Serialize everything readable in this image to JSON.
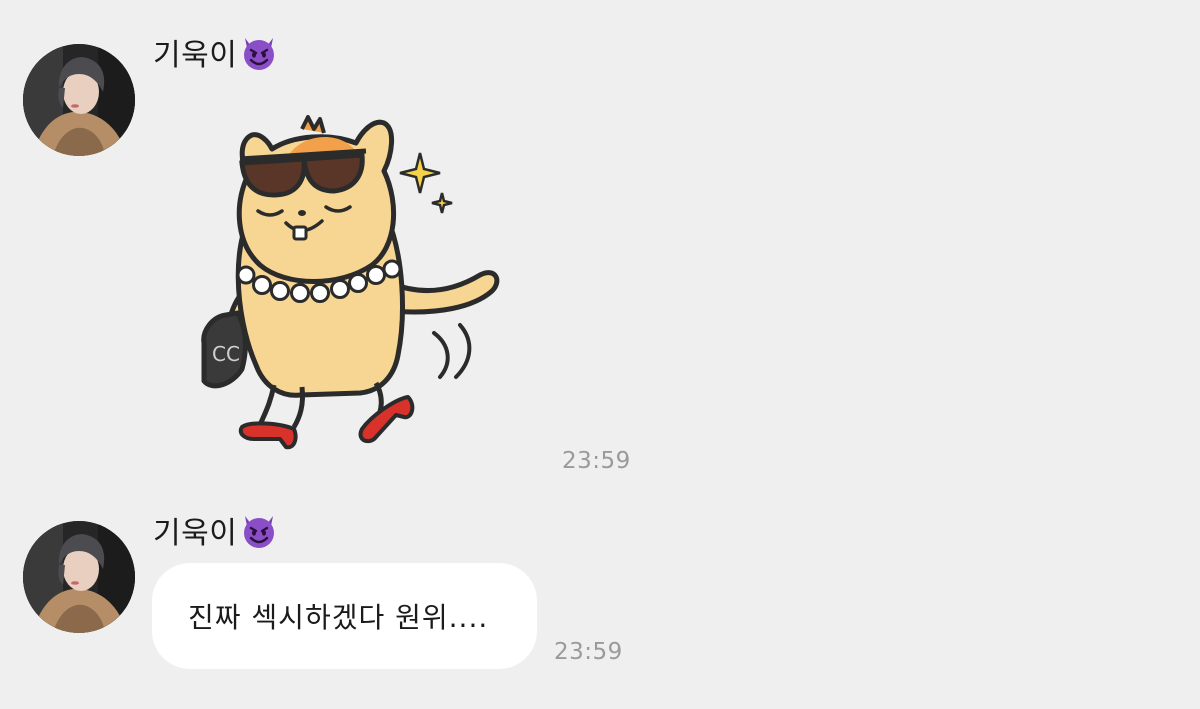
{
  "messages": [
    {
      "sender": "기욱이",
      "sender_emoji_icon": "smiling-devil-icon",
      "type": "sticker",
      "sticker_icon": "hamster-with-sunglasses-sticker",
      "time": "23:59"
    },
    {
      "sender": "기욱이",
      "sender_emoji_icon": "smiling-devil-icon",
      "type": "text",
      "text": "진짜 섹시하겠다 원위....",
      "time": "23:59"
    }
  ],
  "colors": {
    "background": "#efeff0",
    "bubble": "#ffffff",
    "time_text": "#9a9a9c",
    "sender_text": "#1b1b1b",
    "devil_purple": "#7b3fb8",
    "sticker_fill": "#f7d693",
    "sticker_shoes": "#d8322b"
  }
}
